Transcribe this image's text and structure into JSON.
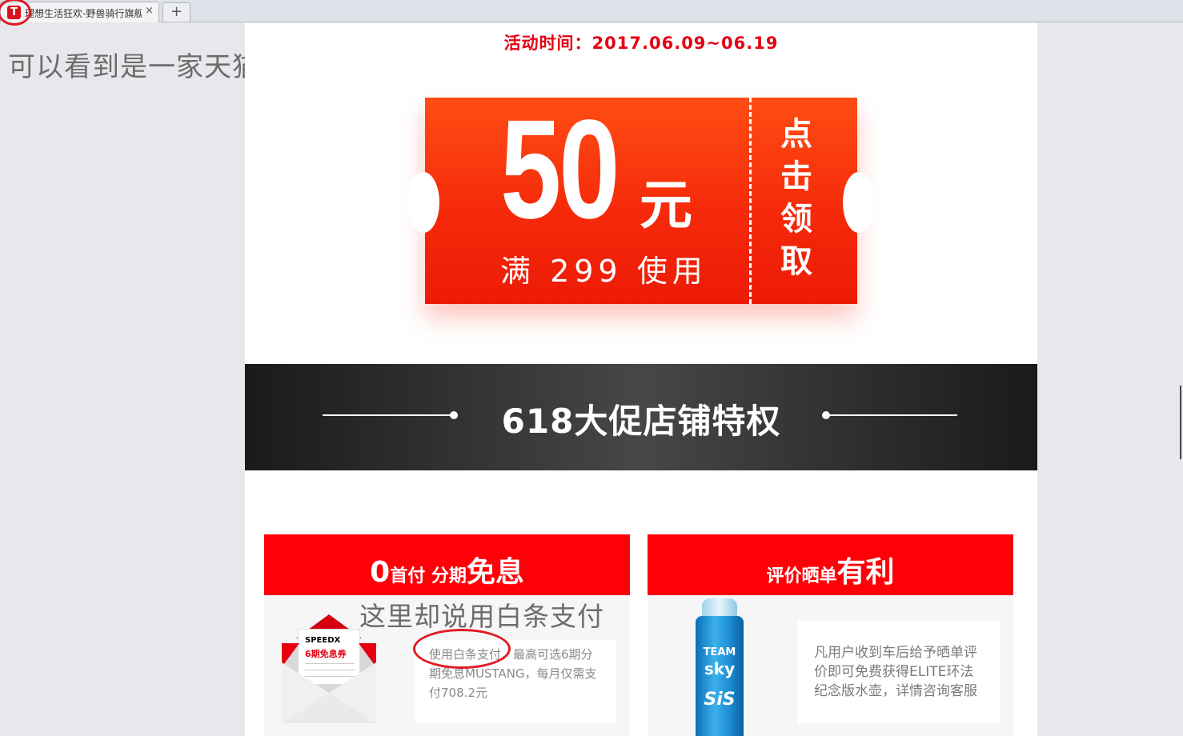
{
  "browser": {
    "tab_title": "理想生活狂欢-野兽骑行旗舰店",
    "favicon_letter": "T",
    "close_glyph": "×",
    "new_tab_glyph": "+"
  },
  "annotations": {
    "top": "可以看到是一家天猫店",
    "middle": "这里却说用白条支付"
  },
  "page": {
    "activity_time": "活动时间：2017.06.09~06.19",
    "coupon": {
      "amount": "50",
      "unit": "元",
      "condition": "满 299 使用",
      "claim_chars": [
        "点",
        "击",
        "领",
        "取"
      ]
    },
    "banner_title": "618大促店铺特权",
    "cards": {
      "left": {
        "title_big_1": "0",
        "title_small_1": "首付 分期",
        "title_big_2": "免息",
        "envelope_brand": "SPEEDX",
        "envelope_coupon": "6期免息券",
        "text": "使用白条支付，最高可选6期分期免息MUSTANG，每月仅需支付708.2元"
      },
      "right": {
        "title_small": "评价晒单",
        "title_big": "有利",
        "bottle_team": "TEAM",
        "bottle_sky": "sky",
        "bottle_sis": "SiS",
        "text": "凡用户收到车后给予晒单评价即可免费获得ELITE环法纪念版水壶，详情咨询客服"
      }
    }
  },
  "colors": {
    "brand_red": "#e60012",
    "coupon_orange": "#ff4d14",
    "annotation_circle": "#e01b22",
    "banner_dark": "#1a1a1a"
  }
}
